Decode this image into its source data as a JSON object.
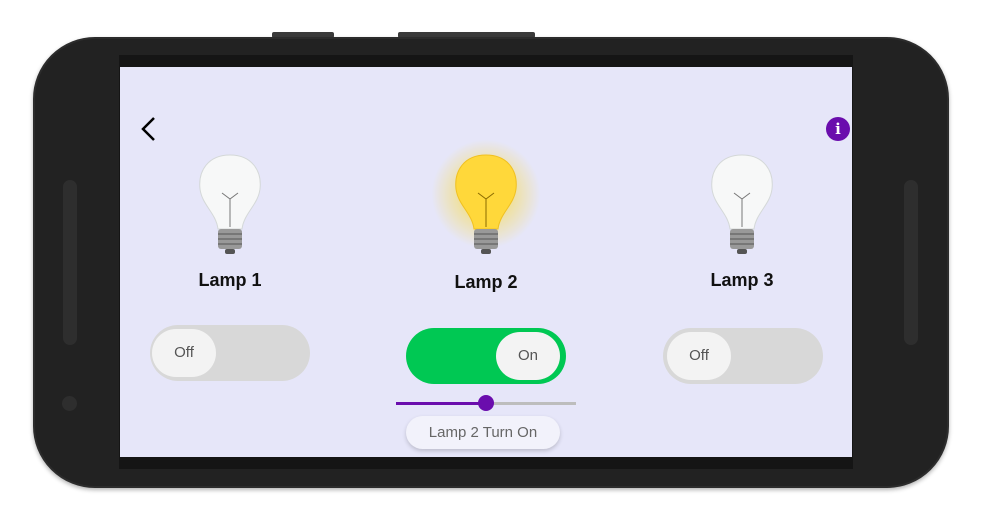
{
  "header": {
    "back_icon": "chevron-left-icon",
    "info_icon": "info-icon",
    "info_glyph": "i"
  },
  "lamps": [
    {
      "name": "Lamp 1",
      "state": "Off",
      "on": false
    },
    {
      "name": "Lamp 2",
      "state": "On",
      "on": true
    },
    {
      "name": "Lamp 3",
      "state": "Off",
      "on": false
    }
  ],
  "brightness": {
    "value": 0.5
  },
  "status_chip": "Lamp 2 Turn On",
  "colors": {
    "accent": "#6a0dad",
    "toggle_on": "#00c853",
    "background": "#e6e6f9"
  }
}
